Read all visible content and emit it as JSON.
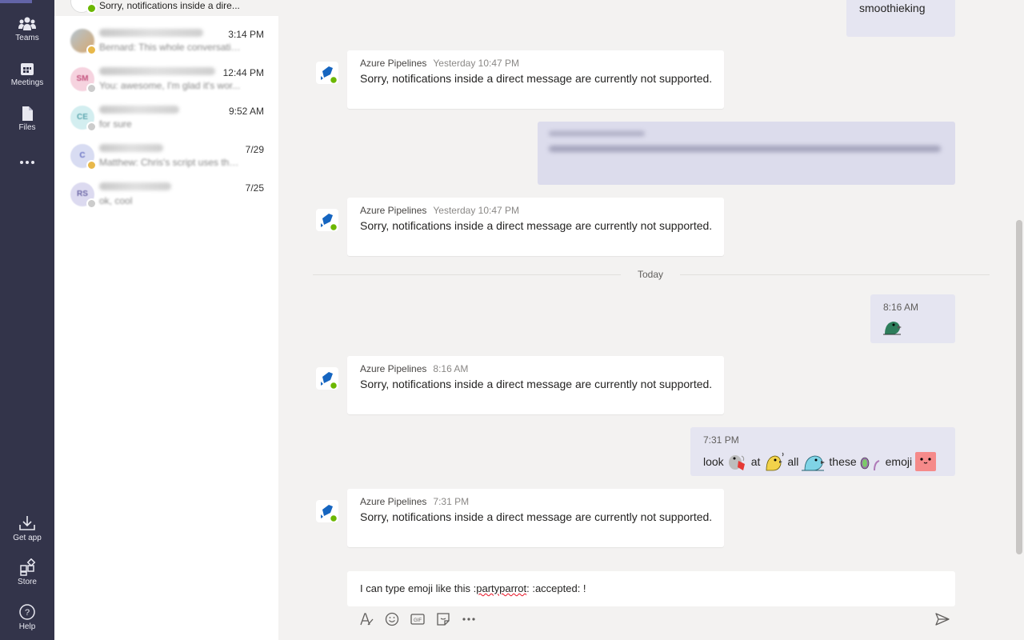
{
  "rail": {
    "items": [
      {
        "label": "Teams",
        "icon": "teams-icon"
      },
      {
        "label": "Meetings",
        "icon": "calendar-icon"
      },
      {
        "label": "Files",
        "icon": "files-icon"
      },
      {
        "label": "...",
        "icon": "more-icon"
      }
    ],
    "bottom_items": [
      {
        "label": "Get app",
        "icon": "download-icon"
      },
      {
        "label": "Store",
        "icon": "store-icon"
      },
      {
        "label": "Help",
        "icon": "help-icon"
      }
    ]
  },
  "chats": [
    {
      "initials": "",
      "time": "",
      "preview": "Sorry, notifications inside a dire...",
      "active": true,
      "presence": "green"
    },
    {
      "initials": "",
      "time": "3:14 PM",
      "preview": "Bernard: This whole conversatio...",
      "presence": "yellow"
    },
    {
      "initials": "SM",
      "time": "12:44 PM",
      "preview": "You: awesome, I'm glad it's wor...",
      "presence": "gray"
    },
    {
      "initials": "CE",
      "time": "9:52 AM",
      "preview": "for sure",
      "presence": "gray"
    },
    {
      "initials": "C",
      "time": "7/29",
      "preview": "Matthew: Chris's script uses the ol...",
      "presence": "yellow"
    },
    {
      "initials": "RS",
      "time": "7/25",
      "preview": "ok, cool",
      "presence": "gray"
    }
  ],
  "conversation": {
    "top_my_text": "smoothieking",
    "messages": [
      {
        "sender": "Azure Pipelines",
        "time": "Yesterday 10:47 PM",
        "text": "Sorry, notifications inside a direct message are currently not supported."
      },
      {
        "sender": "Azure Pipelines",
        "time": "Yesterday 10:47 PM",
        "text": "Sorry, notifications inside a direct message are currently not supported."
      },
      {
        "sender": "Azure Pipelines",
        "time": "8:16 AM",
        "text": "Sorry, notifications inside a direct message are currently not supported."
      },
      {
        "sender": "Azure Pipelines",
        "time": "7:31 PM",
        "text": "Sorry, notifications inside a direct message are currently not supported."
      }
    ],
    "divider": "Today",
    "my_msg_1": {
      "time": "8:16 AM"
    },
    "my_msg_2": {
      "time": "7:31 PM",
      "words": [
        "look",
        "at",
        "all",
        "these",
        "emoji"
      ]
    }
  },
  "compose": {
    "prefix": "I can type emoji like this :",
    "misspelled": "partyparrot",
    "suffix": ": :accepted: !"
  },
  "toolbar": [
    "format-icon",
    "emoji-icon",
    "gif-icon",
    "sticker-icon",
    "more-options-icon",
    "send-icon"
  ],
  "colors": {
    "rail": "#33344a",
    "accent": "#6264a7",
    "my_bubble": "#e5e5f1",
    "presence_available": "#6bb700"
  }
}
